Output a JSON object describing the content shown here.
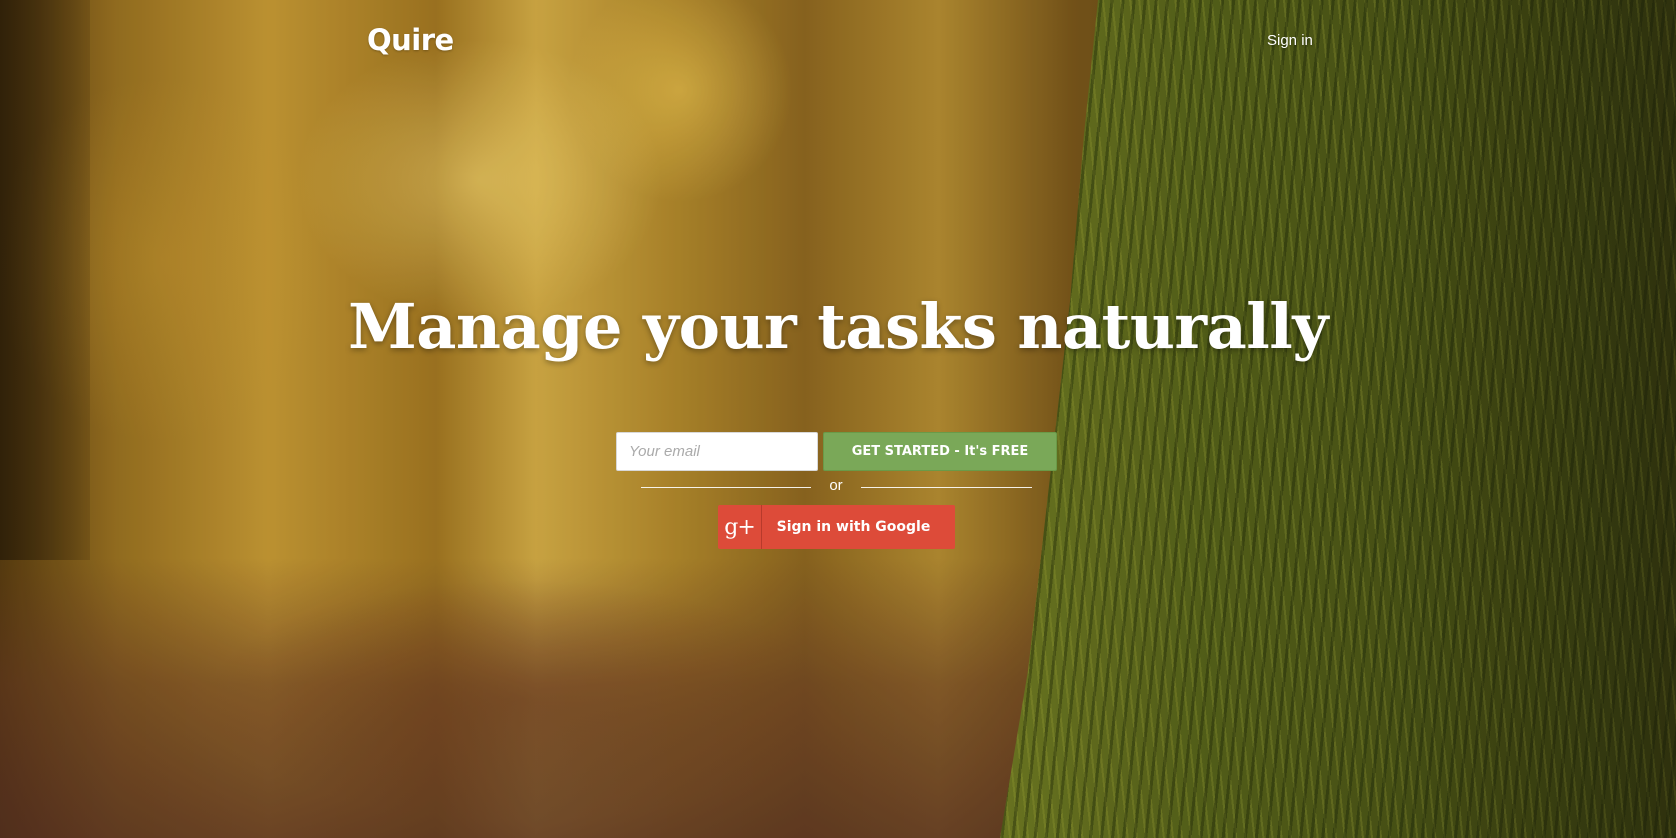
{
  "header": {
    "logo": "Quire",
    "signin_label": "Sign in"
  },
  "hero": {
    "headline": "Manage your tasks naturally"
  },
  "signup": {
    "email_placeholder": "Your email",
    "email_value": "",
    "get_started_label": "GET STARTED - It's FREE",
    "or_label": "or",
    "google_icon_text": "g+",
    "google_label": "Sign in with Google"
  },
  "colors": {
    "get_started_bg": "#7aa858",
    "google_bg": "#dd4b39"
  },
  "icons": {
    "google_plus": "google-plus-icon"
  }
}
